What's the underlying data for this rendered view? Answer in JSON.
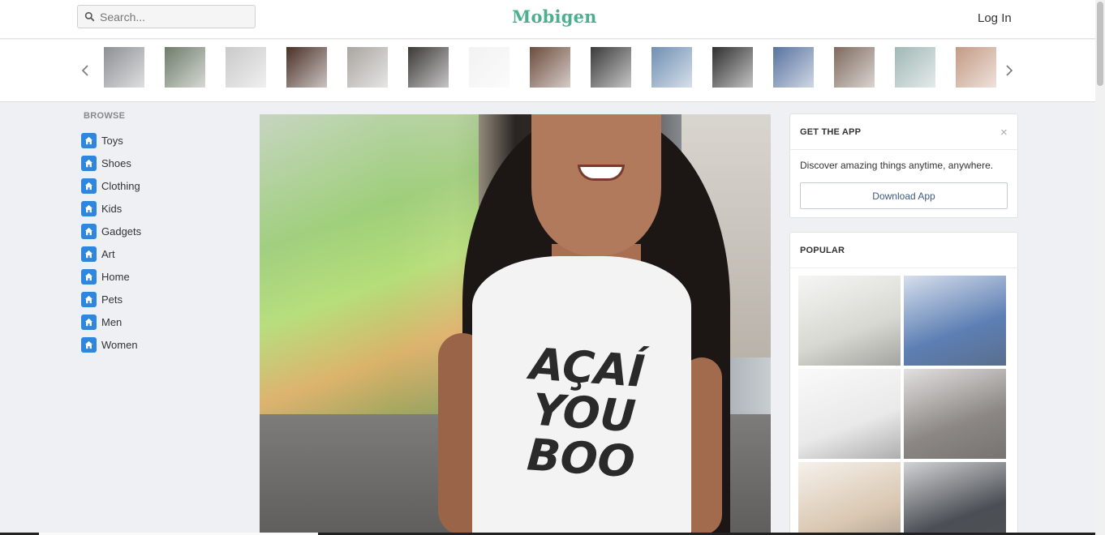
{
  "header": {
    "search_placeholder": "Search...",
    "logo": "Mobigen",
    "login": "Log In"
  },
  "thumb_strip": {
    "items": [
      {
        "icon": "tank-top-photo",
        "color": "#8d8f93"
      },
      {
        "icon": "robot-toy-photo",
        "color": "#6f7c6a"
      },
      {
        "icon": "aviator-sunglasses-photo",
        "color": "#c9c9c9"
      },
      {
        "icon": "hand-joint-photo",
        "color": "#4a3027"
      },
      {
        "icon": "man-tshirt-photo",
        "color": "#a9a5a0"
      },
      {
        "icon": "wristband-photo",
        "color": "#3c3838"
      },
      {
        "icon": "black-sunglasses-photo",
        "color": "#f2f2f2"
      },
      {
        "icon": "wallet-photo",
        "color": "#6d4c3d"
      },
      {
        "icon": "suit-watch-photo",
        "color": "#3a3a3a"
      },
      {
        "icon": "wristwatch-sky-photo",
        "color": "#6f8fb3"
      },
      {
        "icon": "dark-watch-photo",
        "color": "#2f2f2f"
      },
      {
        "icon": "blue-watch-photo",
        "color": "#5873a0"
      },
      {
        "icon": "blonde-woman-photo",
        "color": "#7e6a5e"
      },
      {
        "icon": "scarf-woman-photo",
        "color": "#9fb8b6"
      },
      {
        "icon": "woman-hands-photo",
        "color": "#c49a83"
      }
    ]
  },
  "sidebar": {
    "title": "BROWSE",
    "items": [
      {
        "label": "Toys"
      },
      {
        "label": "Shoes"
      },
      {
        "label": "Clothing"
      },
      {
        "label": "Kids"
      },
      {
        "label": "Gadgets"
      },
      {
        "label": "Art"
      },
      {
        "label": "Home"
      },
      {
        "label": "Pets"
      },
      {
        "label": "Men"
      },
      {
        "label": "Women"
      }
    ]
  },
  "hero": {
    "shirt_text": "AÇAÍ YOU BOO"
  },
  "app_card": {
    "title": "GET THE APP",
    "close": "×",
    "description": "Discover amazing things anytime, anywhere.",
    "button": "Download App"
  },
  "popular": {
    "title": "POPULAR",
    "items": [
      {
        "icon": "white-modular-house-photo",
        "color": "#d8d8d2"
      },
      {
        "icon": "road-rug-photo",
        "color": "#5d7fb4"
      },
      {
        "icon": "cat-device-photo",
        "color": "#e9e9e9"
      },
      {
        "icon": "sneakers-photo",
        "color": "#8c8784"
      },
      {
        "icon": "honeycomb-shelf-photo",
        "color": "#d9c7b1"
      },
      {
        "icon": "printer-device-photo",
        "color": "#4b4f55"
      }
    ]
  },
  "colors": {
    "brand": "#4cb08f",
    "category_icon": "#2e86de",
    "button_text": "#3d5a80"
  }
}
